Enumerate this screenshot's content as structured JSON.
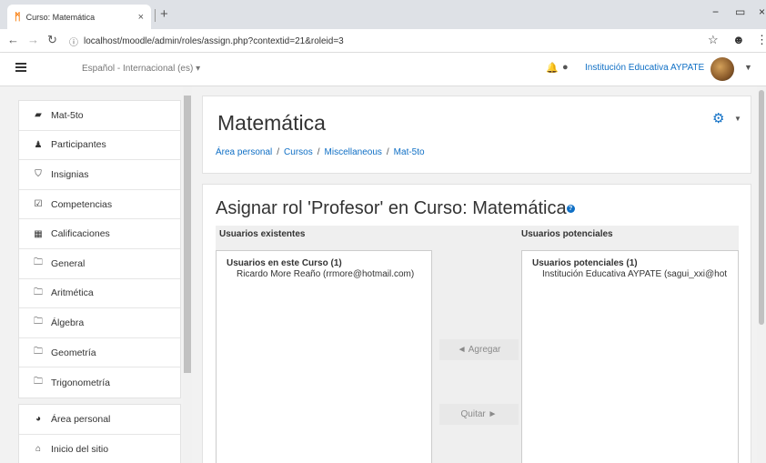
{
  "browser": {
    "tab_title": "Curso: Matemática",
    "tab_close": "×",
    "new_tab": "+",
    "url": "localhost/moodle/admin/roles/assign.php?contextid=21&roleid=3",
    "controls": {
      "minimize": "−",
      "maximize": "▭",
      "close": "×"
    }
  },
  "navbar": {
    "language": "Español - Internacional (es) ▾",
    "username": "Institución Educativa AYPATE"
  },
  "sidebar": {
    "course_items": [
      {
        "icon": "graduation-cap-icon",
        "glyph": "▰",
        "label": "Mat-5to"
      },
      {
        "icon": "users-icon",
        "glyph": "♟",
        "label": "Participantes"
      },
      {
        "icon": "shield-icon",
        "glyph": "⛉",
        "label": "Insignias"
      },
      {
        "icon": "check-square-icon",
        "glyph": "☑",
        "label": "Competencias"
      },
      {
        "icon": "table-icon",
        "glyph": "▦",
        "label": "Calificaciones"
      },
      {
        "icon": "folder-icon",
        "glyph": "🗀",
        "label": "General"
      },
      {
        "icon": "folder-icon",
        "glyph": "🗀",
        "label": "Aritmética"
      },
      {
        "icon": "folder-icon",
        "glyph": "🗀",
        "label": "Álgebra"
      },
      {
        "icon": "folder-icon",
        "glyph": "🗀",
        "label": "Geometría"
      },
      {
        "icon": "folder-icon",
        "glyph": "🗀",
        "label": "Trigonometría"
      }
    ],
    "site_items": [
      {
        "icon": "tachometer-icon",
        "glyph": "◕",
        "label": "Área personal"
      },
      {
        "icon": "home-icon",
        "glyph": "⌂",
        "label": "Inicio del sitio"
      }
    ]
  },
  "header": {
    "course_title": "Matemática",
    "breadcrumb": [
      "Área personal",
      "Cursos",
      "Miscellaneous",
      "Mat-5to"
    ]
  },
  "assign": {
    "heading": "Asignar rol 'Profesor' en Curso: Matemática",
    "existing_header": "Usuarios existentes",
    "potential_header": "Usuarios potenciales",
    "existing_group": "Usuarios en este Curso (1)",
    "existing_users": [
      "Ricardo More Reaño (rrmore@hotmail.com)"
    ],
    "potential_group": "Usuarios potenciales (1)",
    "potential_users": [
      "Institución Educativa AYPATE (sagui_xxi@hot"
    ],
    "add_button": "◄ Agregar",
    "remove_button": "Quitar ►"
  },
  "colors": {
    "link": "#0f6fc5",
    "page_background": "#f2f2f2",
    "moodle_orange": "#f98012"
  }
}
